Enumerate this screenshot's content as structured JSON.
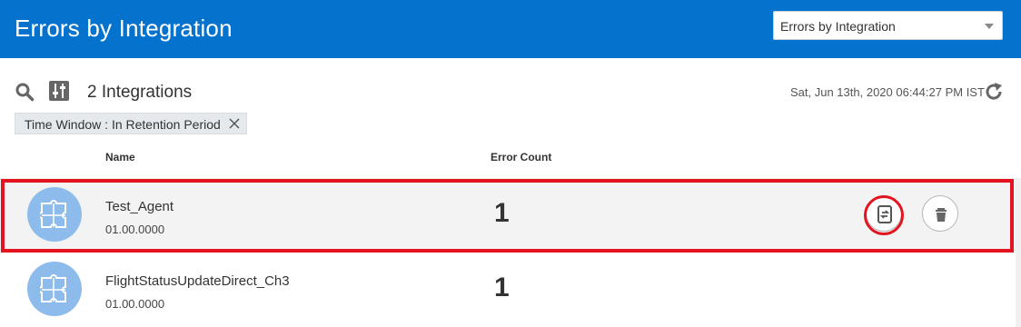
{
  "header": {
    "title": "Errors by Integration",
    "view_selector": {
      "value": "Errors by Integration"
    }
  },
  "toolbar": {
    "count_label": "2 Integrations",
    "timestamp": "Sat, Jun 13th, 2020 06:44:27 PM IST",
    "icons": [
      "search-icon",
      "filter-icon",
      "refresh-icon"
    ]
  },
  "filter_chip": {
    "label": "Time Window : In Retention Period"
  },
  "table": {
    "columns": [
      "Name",
      "Error Count"
    ],
    "rows": [
      {
        "name": "Test_Agent",
        "version": "01.00.0000",
        "error_count": "1"
      },
      {
        "name": "FlightStatusUpdateDirect_Ch3",
        "version": "01.00.0000",
        "error_count": "1"
      }
    ]
  },
  "colors": {
    "header_bg": "#0572ce",
    "avatar_bg": "#8dbcec",
    "highlight": "#e3141f"
  }
}
